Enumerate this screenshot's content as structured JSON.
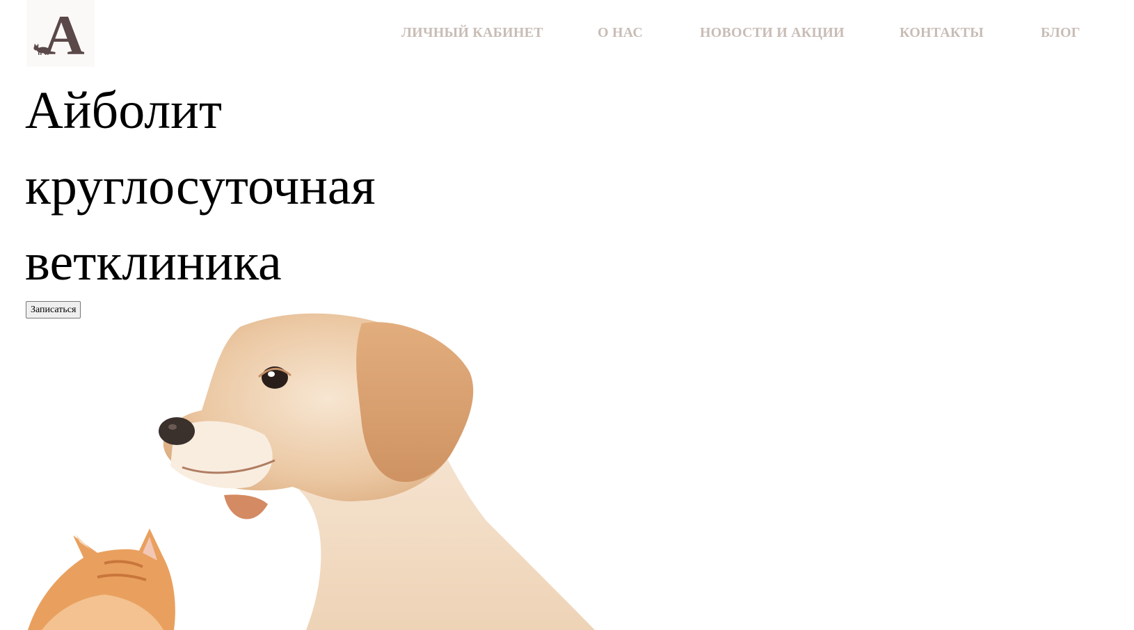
{
  "header": {
    "logo_letter": "A",
    "nav": [
      {
        "label": "ЛИЧНЫЙ КАБИНЕТ"
      },
      {
        "label": "О НАС"
      },
      {
        "label": "НОВОСТИ И АКЦИИ"
      },
      {
        "label": "КОНТАКТЫ"
      },
      {
        "label": "БЛОГ"
      }
    ],
    "nav_color": "#c8bcb6"
  },
  "hero": {
    "title_lines": [
      "Айболит",
      "круглосуточная",
      "ветклиника"
    ],
    "cta_label": "Записаться",
    "image_subject": "puppy and kitten photo"
  },
  "colors": {
    "logo": "#5b4848",
    "background": "#ffffff"
  }
}
